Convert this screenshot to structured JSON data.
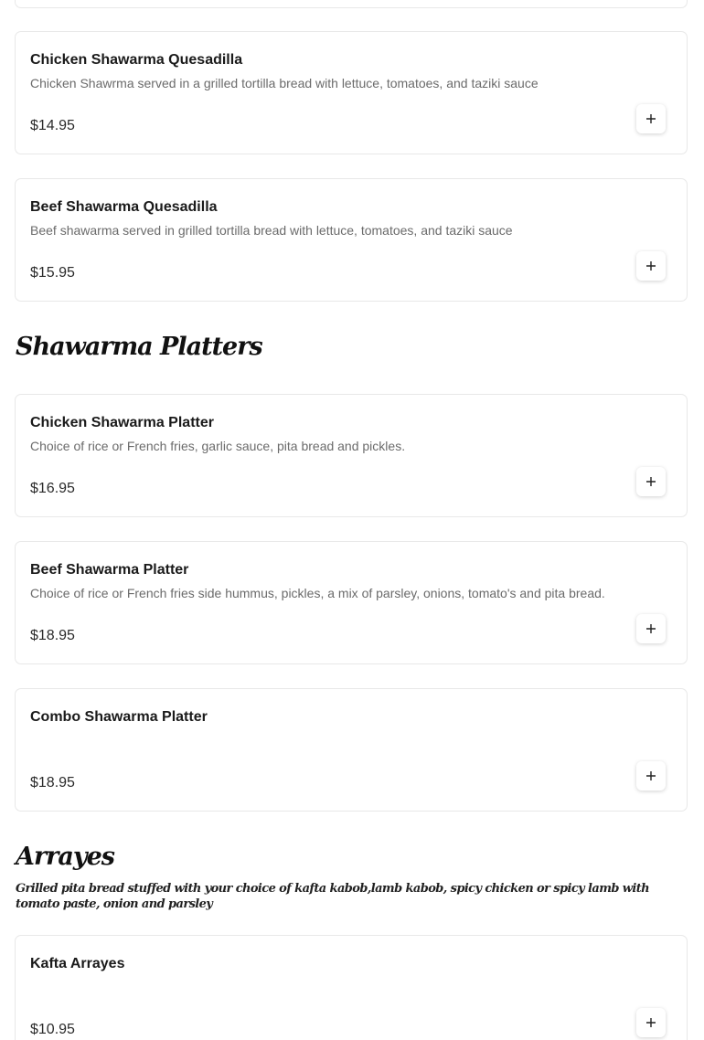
{
  "sections": [
    {
      "items": [
        {
          "name": "Chicken Shawarma Quesadilla",
          "description": "Chicken Shawrma served in a grilled tortilla bread with lettuce, tomatoes, and taziki sauce",
          "price": "$14.95"
        },
        {
          "name": "Beef Shawarma Quesadilla",
          "description": "Beef shawarma served in grilled tortilla bread with lettuce, tomatoes, and taziki sauce",
          "price": "$15.95"
        }
      ]
    },
    {
      "title": "Shawarma Platters",
      "items": [
        {
          "name": "Chicken Shawarma Platter",
          "description": "Choice of rice or French fries, garlic sauce, pita bread and pickles.",
          "price": "$16.95"
        },
        {
          "name": "Beef Shawarma Platter",
          "description": "Choice of rice or French fries side hummus, pickles, a mix of parsley, onions, tomato's and pita bread.",
          "price": "$18.95"
        },
        {
          "name": "Combo Shawarma Platter",
          "description": "",
          "price": "$18.95"
        }
      ]
    },
    {
      "title": "Arrayes",
      "description": "Grilled pita bread stuffed with your choice of kafta kabob,lamb kabob, spicy chicken or spicy lamb with tomato paste, onion and parsley",
      "items": [
        {
          "name": "Kafta Arrayes",
          "description": "",
          "price": "$10.95"
        }
      ]
    }
  ],
  "icons": {
    "add": "plus-icon"
  },
  "colors": {
    "card_border": "#e8e8e8",
    "description_text": "#6b6b6b",
    "title_text": "#1a1a1a"
  }
}
